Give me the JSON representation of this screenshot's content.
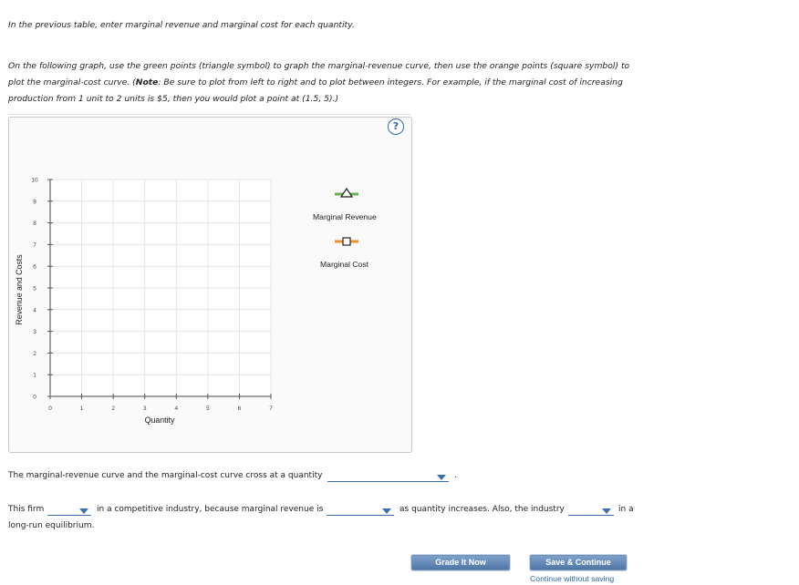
{
  "instructions": {
    "para1": "In the previous table, enter marginal revenue and marginal cost for each quantity.",
    "para2_a": "On the following graph, use the green points (triangle symbol) to graph the marginal-revenue curve, then use the orange points (square symbol) to plot the marginal-cost curve. (",
    "para2_note": "Note",
    "para2_b": ": Be sure to plot from left to right and to plot between integers. For example, if the marginal cost of increasing production from 1 unit to 2 units is $5, then you would plot a point at (1.5, 5).)"
  },
  "graph": {
    "help": "?",
    "x_axis_label": "Quantity",
    "y_axis_label": "Revenue and Costs",
    "x_ticks": [
      "0",
      "1",
      "2",
      "3",
      "4",
      "5",
      "6",
      "7"
    ],
    "y_ticks": [
      "0",
      "1",
      "2",
      "3",
      "4",
      "5",
      "6",
      "7",
      "8",
      "9",
      "10"
    ],
    "x_range": [
      0,
      7
    ],
    "y_range": [
      0,
      10
    ],
    "tools": [
      {
        "label": "Marginal Revenue",
        "symbol": "triangle",
        "color": "#6ab04c"
      },
      {
        "label": "Marginal Cost",
        "symbol": "square",
        "color": "#f0922b"
      }
    ]
  },
  "questions": {
    "q1_text": "The marginal-revenue curve and the marginal-cost curve cross at a quantity",
    "q1_end": ".",
    "q2_a": "This firm",
    "q2_b": "in a competitive industry, because marginal revenue is",
    "q2_c": "as quantity increases. Also, the industry",
    "q2_d": "in a",
    "q2_e": "long-run equilibrium."
  },
  "buttons": {
    "grade": "Grade It Now",
    "save": "Save & Continue",
    "continue_link": "Continue without saving"
  },
  "colors": {
    "accent": "#3d6fb0",
    "grid": "#e4e4e4"
  }
}
